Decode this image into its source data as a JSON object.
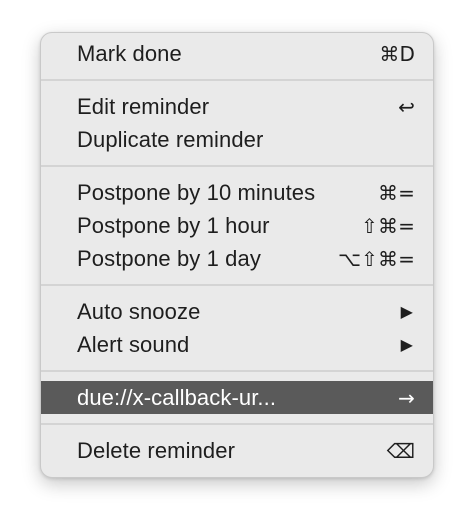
{
  "menu": {
    "items": {
      "mark_done": {
        "label": "Mark done",
        "shortcut": "⌘D"
      },
      "edit_reminder": {
        "label": "Edit reminder",
        "shortcut": "↩"
      },
      "duplicate_reminder": {
        "label": "Duplicate reminder"
      },
      "postpone_10m": {
        "label": "Postpone by 10 minutes",
        "shortcut": "⌘="
      },
      "postpone_1h": {
        "label": "Postpone by 1 hour",
        "shortcut": "⇧⌘="
      },
      "postpone_1d": {
        "label": "Postpone by 1 day",
        "shortcut": "⌥⇧⌘="
      },
      "auto_snooze": {
        "label": "Auto snooze",
        "submenu": "▶"
      },
      "alert_sound": {
        "label": "Alert sound",
        "submenu": "▶"
      },
      "due_url": {
        "label": "due://x-callback-ur...",
        "shortcut": "→"
      },
      "delete_reminder": {
        "label": "Delete reminder",
        "shortcut": "⌫"
      }
    },
    "highlight_color": "#5a5a5a",
    "background_color": "#eaeaea"
  }
}
